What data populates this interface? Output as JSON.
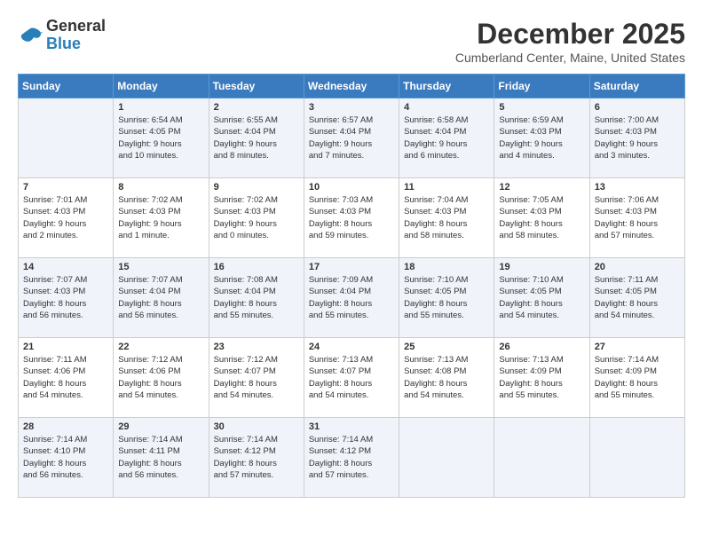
{
  "header": {
    "logo": {
      "general": "General",
      "blue": "Blue"
    },
    "title": "December 2025",
    "subtitle": "Cumberland Center, Maine, United States"
  },
  "calendar": {
    "days_of_week": [
      "Sunday",
      "Monday",
      "Tuesday",
      "Wednesday",
      "Thursday",
      "Friday",
      "Saturday"
    ],
    "weeks": [
      [
        {
          "day": "",
          "info": ""
        },
        {
          "day": "1",
          "info": "Sunrise: 6:54 AM\nSunset: 4:05 PM\nDaylight: 9 hours\nand 10 minutes."
        },
        {
          "day": "2",
          "info": "Sunrise: 6:55 AM\nSunset: 4:04 PM\nDaylight: 9 hours\nand 8 minutes."
        },
        {
          "day": "3",
          "info": "Sunrise: 6:57 AM\nSunset: 4:04 PM\nDaylight: 9 hours\nand 7 minutes."
        },
        {
          "day": "4",
          "info": "Sunrise: 6:58 AM\nSunset: 4:04 PM\nDaylight: 9 hours\nand 6 minutes."
        },
        {
          "day": "5",
          "info": "Sunrise: 6:59 AM\nSunset: 4:03 PM\nDaylight: 9 hours\nand 4 minutes."
        },
        {
          "day": "6",
          "info": "Sunrise: 7:00 AM\nSunset: 4:03 PM\nDaylight: 9 hours\nand 3 minutes."
        }
      ],
      [
        {
          "day": "7",
          "info": "Sunrise: 7:01 AM\nSunset: 4:03 PM\nDaylight: 9 hours\nand 2 minutes."
        },
        {
          "day": "8",
          "info": "Sunrise: 7:02 AM\nSunset: 4:03 PM\nDaylight: 9 hours\nand 1 minute."
        },
        {
          "day": "9",
          "info": "Sunrise: 7:02 AM\nSunset: 4:03 PM\nDaylight: 9 hours\nand 0 minutes."
        },
        {
          "day": "10",
          "info": "Sunrise: 7:03 AM\nSunset: 4:03 PM\nDaylight: 8 hours\nand 59 minutes."
        },
        {
          "day": "11",
          "info": "Sunrise: 7:04 AM\nSunset: 4:03 PM\nDaylight: 8 hours\nand 58 minutes."
        },
        {
          "day": "12",
          "info": "Sunrise: 7:05 AM\nSunset: 4:03 PM\nDaylight: 8 hours\nand 58 minutes."
        },
        {
          "day": "13",
          "info": "Sunrise: 7:06 AM\nSunset: 4:03 PM\nDaylight: 8 hours\nand 57 minutes."
        }
      ],
      [
        {
          "day": "14",
          "info": "Sunrise: 7:07 AM\nSunset: 4:03 PM\nDaylight: 8 hours\nand 56 minutes."
        },
        {
          "day": "15",
          "info": "Sunrise: 7:07 AM\nSunset: 4:04 PM\nDaylight: 8 hours\nand 56 minutes."
        },
        {
          "day": "16",
          "info": "Sunrise: 7:08 AM\nSunset: 4:04 PM\nDaylight: 8 hours\nand 55 minutes."
        },
        {
          "day": "17",
          "info": "Sunrise: 7:09 AM\nSunset: 4:04 PM\nDaylight: 8 hours\nand 55 minutes."
        },
        {
          "day": "18",
          "info": "Sunrise: 7:10 AM\nSunset: 4:05 PM\nDaylight: 8 hours\nand 55 minutes."
        },
        {
          "day": "19",
          "info": "Sunrise: 7:10 AM\nSunset: 4:05 PM\nDaylight: 8 hours\nand 54 minutes."
        },
        {
          "day": "20",
          "info": "Sunrise: 7:11 AM\nSunset: 4:05 PM\nDaylight: 8 hours\nand 54 minutes."
        }
      ],
      [
        {
          "day": "21",
          "info": "Sunrise: 7:11 AM\nSunset: 4:06 PM\nDaylight: 8 hours\nand 54 minutes."
        },
        {
          "day": "22",
          "info": "Sunrise: 7:12 AM\nSunset: 4:06 PM\nDaylight: 8 hours\nand 54 minutes."
        },
        {
          "day": "23",
          "info": "Sunrise: 7:12 AM\nSunset: 4:07 PM\nDaylight: 8 hours\nand 54 minutes."
        },
        {
          "day": "24",
          "info": "Sunrise: 7:13 AM\nSunset: 4:07 PM\nDaylight: 8 hours\nand 54 minutes."
        },
        {
          "day": "25",
          "info": "Sunrise: 7:13 AM\nSunset: 4:08 PM\nDaylight: 8 hours\nand 54 minutes."
        },
        {
          "day": "26",
          "info": "Sunrise: 7:13 AM\nSunset: 4:09 PM\nDaylight: 8 hours\nand 55 minutes."
        },
        {
          "day": "27",
          "info": "Sunrise: 7:14 AM\nSunset: 4:09 PM\nDaylight: 8 hours\nand 55 minutes."
        }
      ],
      [
        {
          "day": "28",
          "info": "Sunrise: 7:14 AM\nSunset: 4:10 PM\nDaylight: 8 hours\nand 56 minutes."
        },
        {
          "day": "29",
          "info": "Sunrise: 7:14 AM\nSunset: 4:11 PM\nDaylight: 8 hours\nand 56 minutes."
        },
        {
          "day": "30",
          "info": "Sunrise: 7:14 AM\nSunset: 4:12 PM\nDaylight: 8 hours\nand 57 minutes."
        },
        {
          "day": "31",
          "info": "Sunrise: 7:14 AM\nSunset: 4:12 PM\nDaylight: 8 hours\nand 57 minutes."
        },
        {
          "day": "",
          "info": ""
        },
        {
          "day": "",
          "info": ""
        },
        {
          "day": "",
          "info": ""
        }
      ]
    ]
  }
}
